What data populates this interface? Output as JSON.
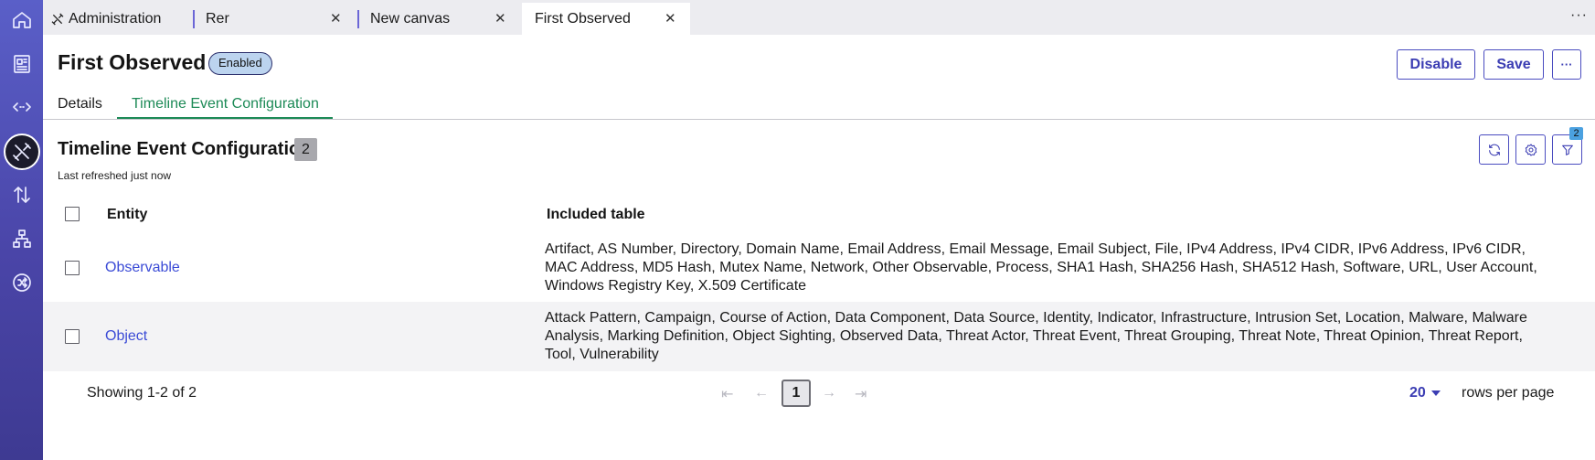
{
  "tabs": [
    {
      "label": "Administration",
      "icon": "tools-icon",
      "closable": false
    },
    {
      "label": "Rer",
      "closable": true
    },
    {
      "label": "New canvas",
      "closable": true
    },
    {
      "label": "First Observed",
      "closable": true,
      "active": true
    }
  ],
  "tabs_overflow": "···",
  "close_glyph": "✕",
  "rail": {
    "items": [
      "home-icon",
      "dashboard-icon",
      "code-icon",
      "administration-icon",
      "transfer-icon",
      "hierarchy-icon",
      "shuffle-icon"
    ],
    "active": "administration-icon"
  },
  "header": {
    "title": "First Observed",
    "status_badge": "Enabled",
    "disable_label": "Disable",
    "save_label": "Save",
    "more_label": "···"
  },
  "subtabs": [
    {
      "label": "Details"
    },
    {
      "label": "Timeline Event Configuration",
      "active": true
    }
  ],
  "section": {
    "title": "Timeline Event Configuration",
    "count": "2",
    "refreshed": "Last refreshed just now",
    "filter_count": "2"
  },
  "table": {
    "columns": [
      "Entity",
      "Included table"
    ],
    "rows": [
      {
        "entity": "Observable",
        "included": "Artifact, AS Number, Directory, Domain Name, Email Address, Email Message, Email Subject, File, IPv4 Address, IPv4 CIDR, IPv6 Address, IPv6 CIDR, MAC Address, MD5 Hash, Mutex Name, Network, Other Observable, Process, SHA1 Hash, SHA256 Hash, SHA512 Hash, Software, URL, User Account, Windows Registry Key, X.509 Certificate"
      },
      {
        "entity": "Object",
        "included": "Attack Pattern, Campaign, Course of Action, Data Component, Data Source, Identity, Indicator, Infrastructure, Intrusion Set, Location, Malware, Malware Analysis, Marking Definition, Object Sighting, Observed Data, Threat Actor, Threat Event, Threat Grouping, Threat Note, Threat Opinion, Threat Report, Tool, Vulnerability"
      }
    ]
  },
  "pagination": {
    "showing": "Showing 1-2 of 2",
    "current_page": "1",
    "rows_per_page": "20",
    "rows_per_page_label": "rows per page"
  },
  "colors": {
    "accent": "#3b3db3",
    "active_tab_green": "#1c8a56",
    "link": "#3b4bd6",
    "rail": "#4a45a8"
  }
}
